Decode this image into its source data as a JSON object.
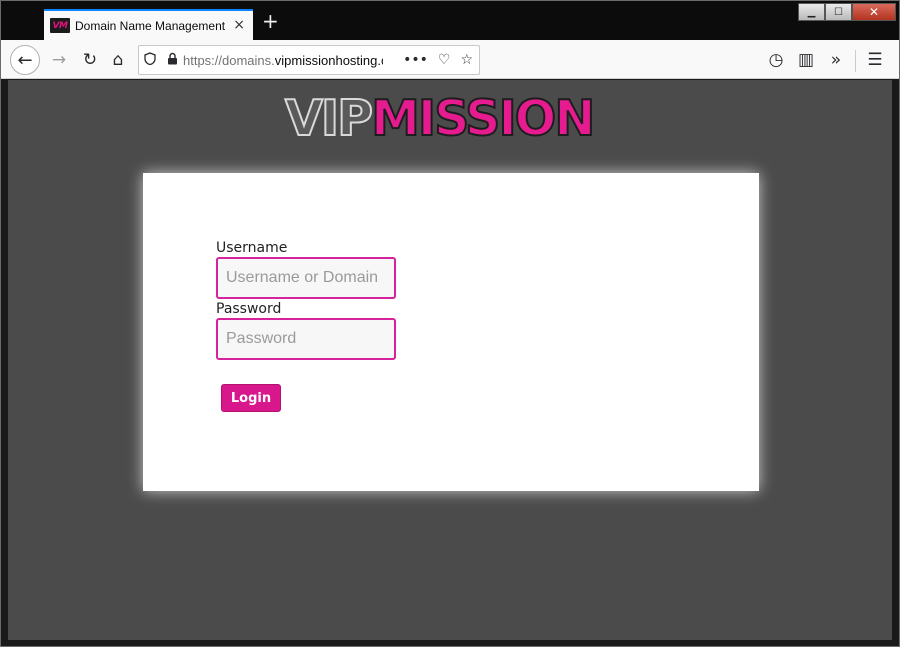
{
  "browser": {
    "tab": {
      "favicon_text": "VM",
      "title": "Domain Name Management",
      "close_glyph": "×"
    },
    "new_tab_glyph": "+",
    "window_controls": {
      "minimize": "▁",
      "maximize": "☐",
      "close": "✕"
    },
    "nav": {
      "back_glyph": "←",
      "forward_glyph": "→",
      "reload_glyph": "↻",
      "home_glyph": "⌂",
      "url_prefix": "https://domains.",
      "url_domain": "vipmissionhosting.c",
      "more_glyph": "•••",
      "pocket_glyph": "♡",
      "bookmark_glyph": "☆",
      "history_glyph": "◷",
      "sidebar_glyph": "▥",
      "overflow_glyph": "»",
      "menu_glyph": "☰"
    }
  },
  "page": {
    "logo": {
      "part1": "VIP",
      "part2": "MISSION"
    },
    "form": {
      "username_label": "Username",
      "username_placeholder": "Username or Domain",
      "password_label": "Password",
      "password_placeholder": "Password",
      "login_label": "Login"
    },
    "colors": {
      "accent": "#d8178d",
      "background": "#4b4b4b"
    }
  }
}
